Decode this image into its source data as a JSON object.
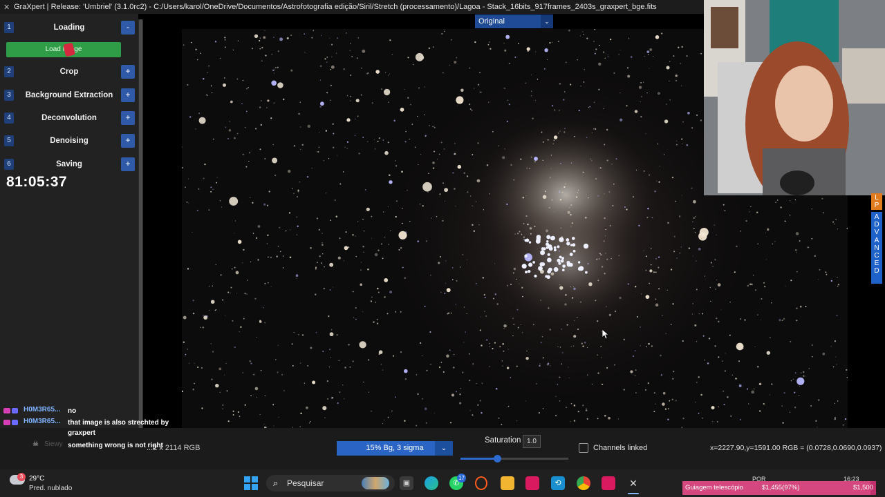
{
  "window": {
    "title": "GraXpert | Release: 'Umbriel' (3.1.0rc2) - C:/Users/karol/OneDrive/Documentos/Astrofotografia edição/Siril/Stretch (processamento)/Lagoa - Stack_16bits_917frames_2403s_graxpert_bge.fits"
  },
  "sidebar": {
    "steps": [
      {
        "num": "1",
        "label": "Loading",
        "toggle": "-"
      },
      {
        "num": "2",
        "label": "Crop",
        "toggle": "+"
      },
      {
        "num": "3",
        "label": "Background Extraction",
        "toggle": "+"
      },
      {
        "num": "4",
        "label": "Deconvolution",
        "toggle": "+"
      },
      {
        "num": "5",
        "label": "Denoising",
        "toggle": "+"
      },
      {
        "num": "6",
        "label": "Saving",
        "toggle": "+"
      }
    ],
    "load_button": "Load Image"
  },
  "stream_timer": "81:05:37",
  "viewer": {
    "display_mode": "Original",
    "mode_chevron": "⌄"
  },
  "side_tabs": {
    "lp": [
      "L",
      "P"
    ],
    "advanced": [
      "A",
      "D",
      "V",
      "A",
      "N",
      "C",
      "E",
      "D"
    ]
  },
  "chat": [
    {
      "user": "H0M3R65...",
      "message": "no"
    },
    {
      "user": "H0M3R65...",
      "message": "that image is also strechted by graxpert"
    },
    {
      "user": "Siewy",
      "message": "something wrong is not right"
    }
  ],
  "statusbar": {
    "resolution": "...2 x 2114 RGB",
    "stretch_option": "15% Bg, 3 sigma",
    "saturation_label": "Saturation",
    "saturation_value": "1.0",
    "saturation_level": 0.34,
    "channels_linked_label": "Channels linked",
    "channels_linked": false,
    "pixel_readout": "x=2227.90,y=1591.00  RGB = (0.0728,0.0690,0.0937)"
  },
  "taskbar": {
    "weather_badge": "3",
    "temperature": "29°C",
    "weather_desc": "Pred. nublado",
    "search_placeholder": "Pesquisar",
    "whatsapp_badge": "17",
    "language": "POR",
    "time": "16:23"
  },
  "goal_bar": {
    "label": "Guiagem telescópio",
    "progress": "$1,455(97%)",
    "target": "$1,500",
    "fraction": 0.97
  },
  "colors": {
    "accent_blue": "#2a64c4",
    "load_green": "#2f9d47",
    "goal_pink": "#c2306e"
  }
}
